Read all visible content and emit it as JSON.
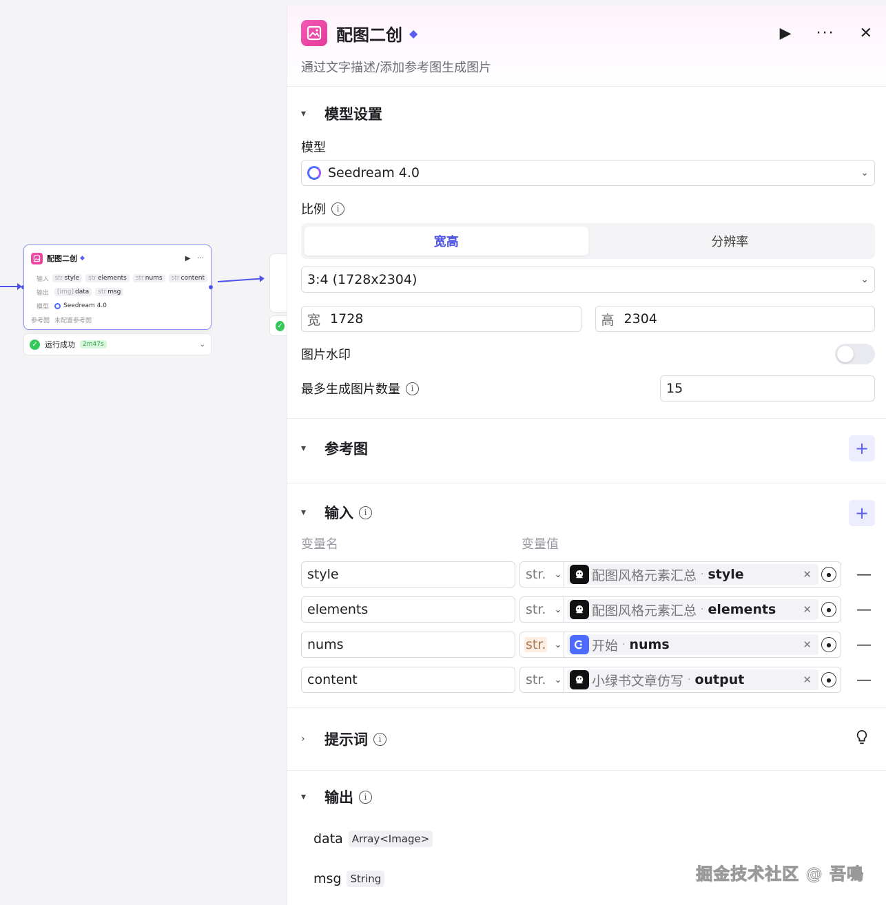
{
  "canvas": {
    "node": {
      "title": "配图二创",
      "play": "▶",
      "more": "···",
      "input_label": "输入",
      "inputs": [
        {
          "type": "str",
          "name": "style"
        },
        {
          "type": "str",
          "name": "elements"
        },
        {
          "type": "str",
          "name": "nums"
        },
        {
          "type": "str",
          "name": "content"
        }
      ],
      "output_label": "输出",
      "outputs": [
        {
          "type": "[img]",
          "name": "data"
        },
        {
          "type": "str",
          "name": "msg"
        }
      ],
      "model_label": "模型",
      "model_value": "Seedream 4.0",
      "ref_label": "参考图",
      "ref_value": "未配置参考图"
    },
    "status": {
      "text": "运行成功",
      "time": "2m47s",
      "status_color": "#34c759"
    }
  },
  "panel": {
    "title": "配图二创",
    "description": "通过文字描述/添加参考图生成图片",
    "accent_color": "#4d53e8",
    "model_settings": {
      "title": "模型设置",
      "model_label": "模型",
      "model_value": "Seedream 4.0",
      "ratio_label": "比例",
      "ratio_tabs": [
        "宽高",
        "分辨率"
      ],
      "ratio_selected": "3:4 (1728x2304)",
      "width_label": "宽",
      "width_value": "1728",
      "height_label": "高",
      "height_value": "2304",
      "watermark_label": "图片水印",
      "watermark_on": false,
      "max_count_label": "最多生成图片数量",
      "max_count_value": "15"
    },
    "reference": {
      "title": "参考图"
    },
    "inputs": {
      "title": "输入",
      "col_name": "变量名",
      "col_value": "变量值",
      "rows": [
        {
          "name": "style",
          "type": "str.",
          "node": "配图风格元素汇总",
          "var": "style",
          "icon": "bot-icon"
        },
        {
          "name": "elements",
          "type": "str.",
          "node": "配图风格元素汇总",
          "var": "elements",
          "icon": "bot-icon"
        },
        {
          "name": "nums",
          "type": "str.",
          "node": "开始",
          "var": "nums",
          "icon": "start-icon"
        },
        {
          "name": "content",
          "type": "str.",
          "node": "小绿书文章仿写",
          "var": "output",
          "icon": "bot-icon"
        }
      ]
    },
    "prompt": {
      "title": "提示词"
    },
    "outputs": {
      "title": "输出",
      "rows": [
        {
          "name": "data",
          "type": "Array<Image>"
        },
        {
          "name": "msg",
          "type": "String"
        }
      ]
    }
  },
  "watermark": "掘金技术社区 @ 吾鳴"
}
